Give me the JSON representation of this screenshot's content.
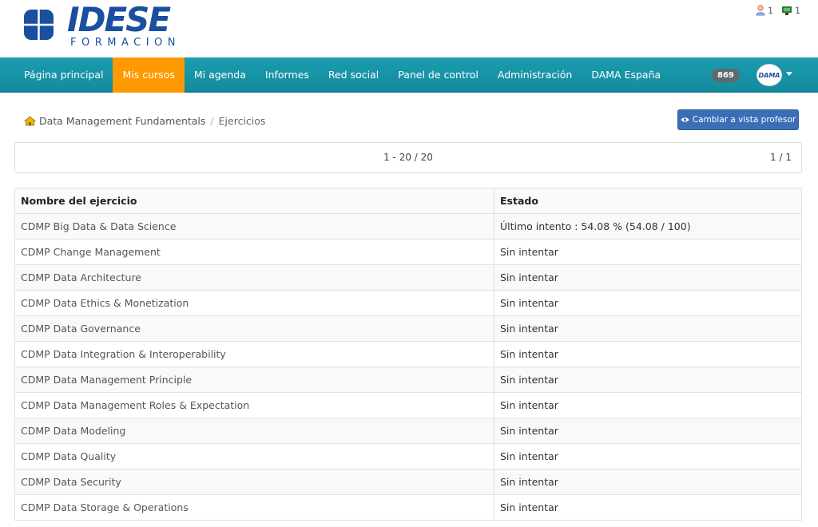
{
  "brand": {
    "name": "IDESE",
    "sub": "FORMACION"
  },
  "top_icons": [
    {
      "icon": "user-icon",
      "count": "1"
    },
    {
      "icon": "chat-icon",
      "count": "1"
    }
  ],
  "nav": {
    "items": [
      {
        "label": "Página principal",
        "active": false
      },
      {
        "label": "Mis cursos",
        "active": true
      },
      {
        "label": "Mi agenda",
        "active": false
      },
      {
        "label": "Informes",
        "active": false
      },
      {
        "label": "Red social",
        "active": false
      },
      {
        "label": "Panel de control",
        "active": false
      },
      {
        "label": "Administración",
        "active": false
      },
      {
        "label": "DAMA España",
        "active": false
      }
    ],
    "badge": "869",
    "avatar_text": "DAMA"
  },
  "breadcrumb": {
    "course": "Data Management Fundamentals",
    "separator": "/",
    "current": "Ejercicios"
  },
  "teacher_button": "Cambiar a vista profesor",
  "pager": {
    "range": "1 - 20 / 20",
    "page": "1 / 1"
  },
  "table": {
    "headers": {
      "name": "Nombre del ejercicio",
      "status": "Estado"
    },
    "rows": [
      {
        "name": "CDMP Big Data & Data Science",
        "status": "Último intento : 54.08 % (54.08 / 100)"
      },
      {
        "name": "CDMP Change Management",
        "status": "Sin intentar"
      },
      {
        "name": "CDMP Data Architecture",
        "status": "Sin intentar"
      },
      {
        "name": "CDMP Data Ethics & Monetization",
        "status": "Sin intentar"
      },
      {
        "name": "CDMP Data Governance",
        "status": "Sin intentar"
      },
      {
        "name": "CDMP Data Integration & Interoperability",
        "status": "Sin intentar"
      },
      {
        "name": "CDMP Data Management Principle",
        "status": "Sin intentar"
      },
      {
        "name": "CDMP Data Management Roles & Expectation",
        "status": "Sin intentar"
      },
      {
        "name": "CDMP Data Modeling",
        "status": "Sin intentar"
      },
      {
        "name": "CDMP Data Quality",
        "status": "Sin intentar"
      },
      {
        "name": "CDMP Data Security",
        "status": "Sin intentar"
      },
      {
        "name": "CDMP Data Storage & Operations",
        "status": "Sin intentar"
      }
    ]
  },
  "colors": {
    "navbar": "#1a9cb0",
    "active_tab": "#ff9900",
    "button": "#3a6fb6",
    "logo": "#1a4fa0"
  }
}
